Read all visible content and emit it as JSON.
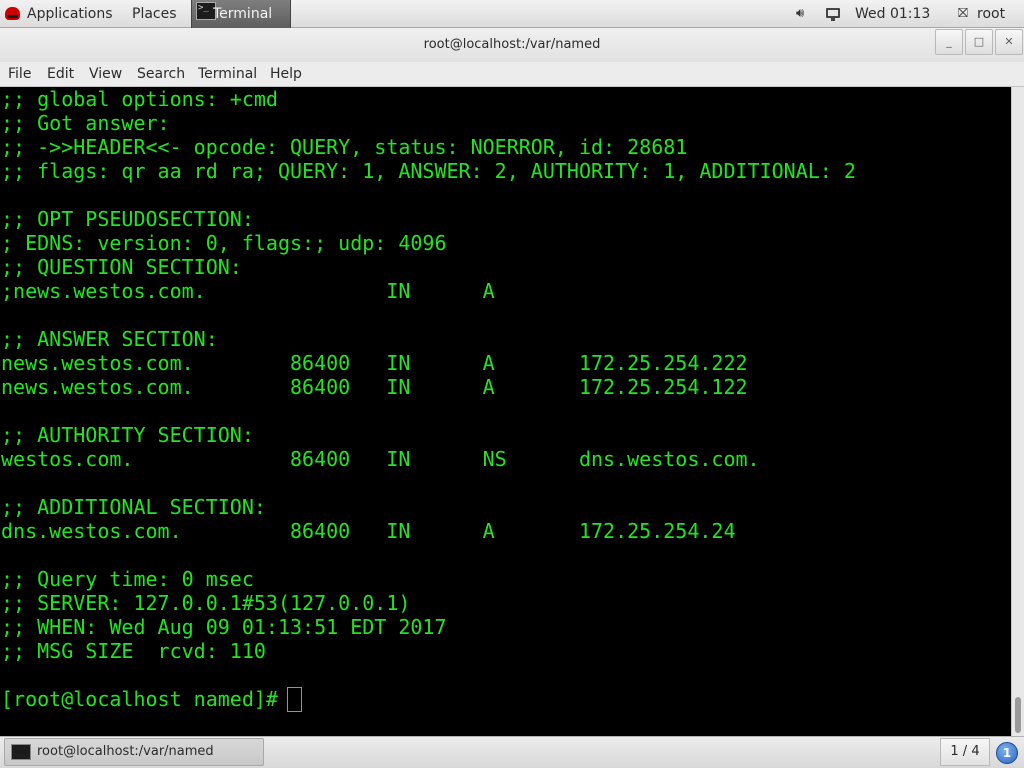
{
  "top_panel": {
    "applications": "Applications",
    "places": "Places",
    "task_label": "Terminal",
    "clock": "Wed 01:13",
    "user": "root"
  },
  "window": {
    "title": "root@localhost:/var/named",
    "minimize": "_",
    "maximize": "□",
    "close": "✕"
  },
  "menubar": {
    "items": [
      "File",
      "Edit",
      "View",
      "Search",
      "Terminal",
      "Help"
    ]
  },
  "terminal": {
    "lines": [
      ";; global options: +cmd",
      ";; Got answer:",
      ";; ->>HEADER<<- opcode: QUERY, status: NOERROR, id: 28681",
      ";; flags: qr aa rd ra; QUERY: 1, ANSWER: 2, AUTHORITY: 1, ADDITIONAL: 2",
      "",
      ";; OPT PSEUDOSECTION:",
      "; EDNS: version: 0, flags:; udp: 4096",
      ";; QUESTION SECTION:",
      ";news.westos.com.               IN      A",
      "",
      ";; ANSWER SECTION:",
      "news.westos.com.        86400   IN      A       172.25.254.222",
      "news.westos.com.        86400   IN      A       172.25.254.122",
      "",
      ";; AUTHORITY SECTION:",
      "westos.com.             86400   IN      NS      dns.westos.com.",
      "",
      ";; ADDITIONAL SECTION:",
      "dns.westos.com.         86400   IN      A       172.25.254.24",
      "",
      ";; Query time: 0 msec",
      ";; SERVER: 127.0.0.1#53(127.0.0.1)",
      ";; WHEN: Wed Aug 09 01:13:51 EDT 2017",
      ";; MSG SIZE  rcvd: 110",
      "",
      "[root@localhost named]# "
    ]
  },
  "bottom_panel": {
    "task_label": "root@localhost:/var/named",
    "workspace": "1 / 4",
    "notification_count": "1"
  },
  "colors": {
    "terminal_fg": "#23e323",
    "terminal_bg": "#000000",
    "panel_bg": "#e6e6e6"
  }
}
